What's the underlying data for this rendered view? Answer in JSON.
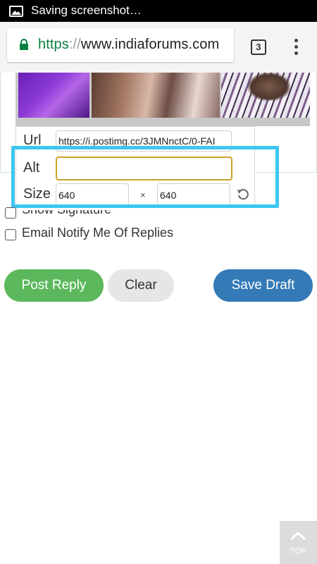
{
  "status_bar": {
    "notification_text": "Saving screenshot…",
    "icon": "image-icon"
  },
  "browser": {
    "url_scheme": "https",
    "url_separator": "://",
    "url_host": "www.indiaforums.com",
    "tab_count": "3",
    "lock_color": "#0b8043"
  },
  "image_dialog": {
    "url_label": "Url",
    "url_value": "https://i.postimg.cc/3JMNnctC/0-FAI",
    "alt_label": "Alt",
    "alt_value": "",
    "size_label": "Size",
    "width_value": "640",
    "times_sign": "×",
    "height_value": "640"
  },
  "options": {
    "show_signature_label": "Show Signature",
    "email_notify_label": "Email Notify Me Of Replies"
  },
  "actions": {
    "post_reply_label": "Post Reply",
    "clear_label": "Clear",
    "save_draft_label": "Save Draft"
  },
  "scroll_top": {
    "label": "TOP"
  },
  "colors": {
    "post_reply": "#5cb85c",
    "save_draft": "#337ab7",
    "highlight": "#3dc6f0"
  }
}
